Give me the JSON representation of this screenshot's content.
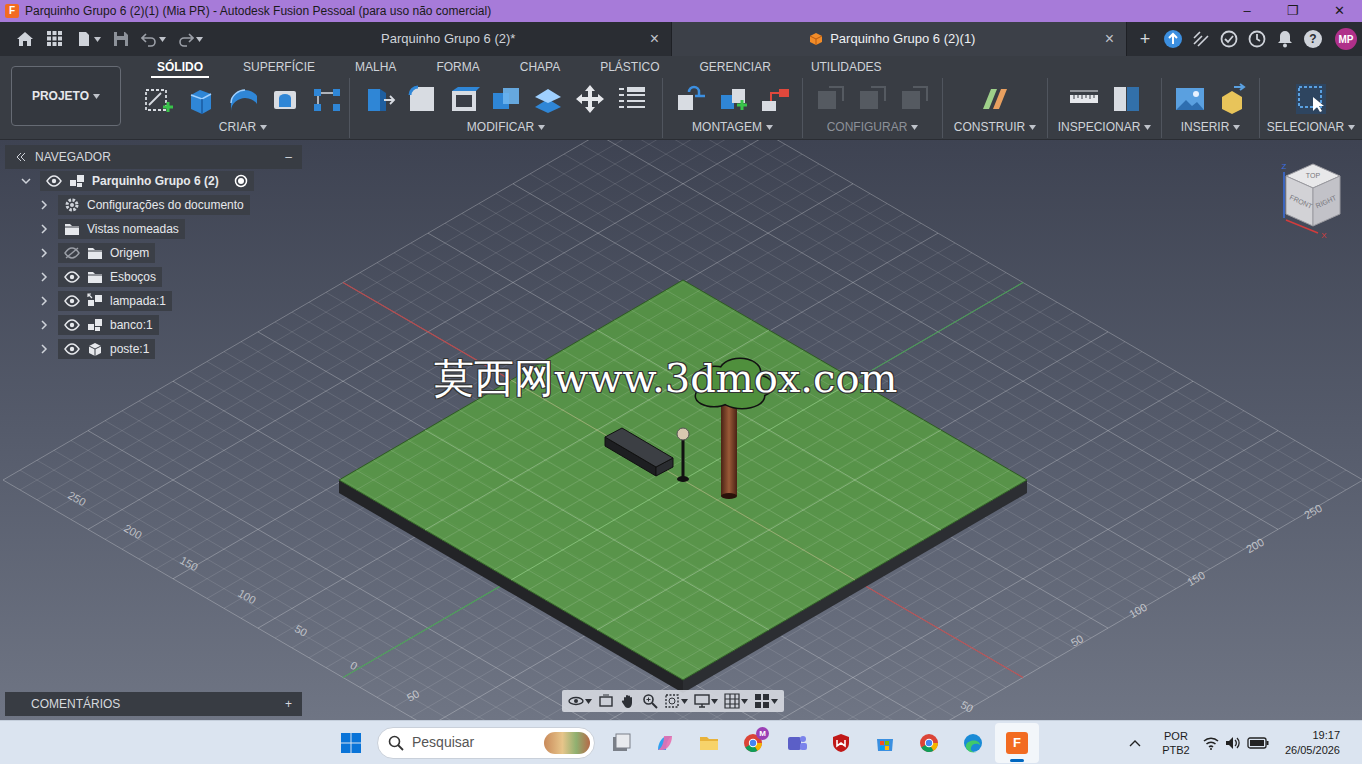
{
  "window": {
    "logo": "F",
    "title": "Parquinho Grupo 6 (2)(1) (Mia PR) - Autodesk Fusion Pessoal (para uso não comercial)",
    "controls": [
      "–",
      "❐",
      "✕"
    ]
  },
  "doc_tabs": [
    {
      "label": "Parquinho Grupo 6 (2)*",
      "close": "×",
      "selected": false
    },
    {
      "label": "Parquinho Grupo 6 (2)(1)",
      "close": "×",
      "selected": true
    }
  ],
  "new_tab": "+",
  "help": "?",
  "user": {
    "initials": "MP"
  },
  "toolbar": {
    "project": "PROJETO",
    "tabs": [
      {
        "label": "SÓLIDO",
        "selected": true
      },
      {
        "label": "SUPERFÍCIE",
        "selected": false
      },
      {
        "label": "MALHA",
        "selected": false
      },
      {
        "label": "FORMA",
        "selected": false
      },
      {
        "label": "CHAPA",
        "selected": false
      },
      {
        "label": "PLÁSTICO",
        "selected": false
      },
      {
        "label": "GERENCIAR",
        "selected": false
      },
      {
        "label": "UTILIDADES",
        "selected": false
      }
    ],
    "groups": [
      {
        "label": "CRIAR",
        "disabled": false
      },
      {
        "label": "MODIFICAR",
        "disabled": false
      },
      {
        "label": "MONTAGEM",
        "disabled": false
      },
      {
        "label": "CONFIGURAR",
        "disabled": true
      },
      {
        "label": "CONSTRUIR",
        "disabled": false
      },
      {
        "label": "INSPECIONAR",
        "disabled": false
      },
      {
        "label": "INSERIR",
        "disabled": false
      },
      {
        "label": "SELECIONAR",
        "disabled": false
      }
    ]
  },
  "navigator": {
    "title": "NAVEGADOR",
    "collapse": "–",
    "root": {
      "label": "Parquinho Grupo 6 (2)",
      "expanded": true,
      "visible": true,
      "active": true
    },
    "items": [
      {
        "label": "Configurações do documento",
        "kind": "settings",
        "expanded": false
      },
      {
        "label": "Vistas nomeadas",
        "kind": "views",
        "expanded": false
      },
      {
        "label": "Origem",
        "kind": "folder",
        "expanded": false,
        "visible": false
      },
      {
        "label": "Esboços",
        "kind": "folder",
        "expanded": false,
        "visible": true
      },
      {
        "label": "lampada:1",
        "kind": "linked-component",
        "expanded": false,
        "visible": true
      },
      {
        "label": "banco:1",
        "kind": "component",
        "expanded": false,
        "visible": true
      },
      {
        "label": "poste:1",
        "kind": "body",
        "expanded": false,
        "visible": true
      }
    ]
  },
  "comments": {
    "title": "COMENTÁRIOS",
    "add": "+"
  },
  "viewcube": {
    "faces": [
      "TOP",
      "FRONT",
      "RIGHT"
    ],
    "axes": [
      "Z",
      "X"
    ]
  },
  "watermark": "莫西网www.3dmox.com",
  "grid_labels": {
    "left": [
      "250",
      "200",
      "150",
      "100",
      "50",
      "0"
    ],
    "right": [
      "250",
      "200",
      "150",
      "100",
      "50"
    ],
    "bottom": [
      "50",
      "50"
    ]
  },
  "taskbar": {
    "search": "Pesquisar",
    "apps": [
      {
        "selected": false
      },
      {
        "selected": false
      },
      {
        "selected": false
      },
      {
        "selected": false,
        "badge": "M"
      },
      {
        "selected": false
      },
      {
        "selected": false
      },
      {
        "selected": false
      },
      {
        "selected": false
      },
      {
        "selected": false
      },
      {
        "selected": true,
        "badge": "F"
      }
    ],
    "lang": [
      "POR",
      "PTB2"
    ],
    "time": "19:17",
    "date": "26/05/2026"
  }
}
